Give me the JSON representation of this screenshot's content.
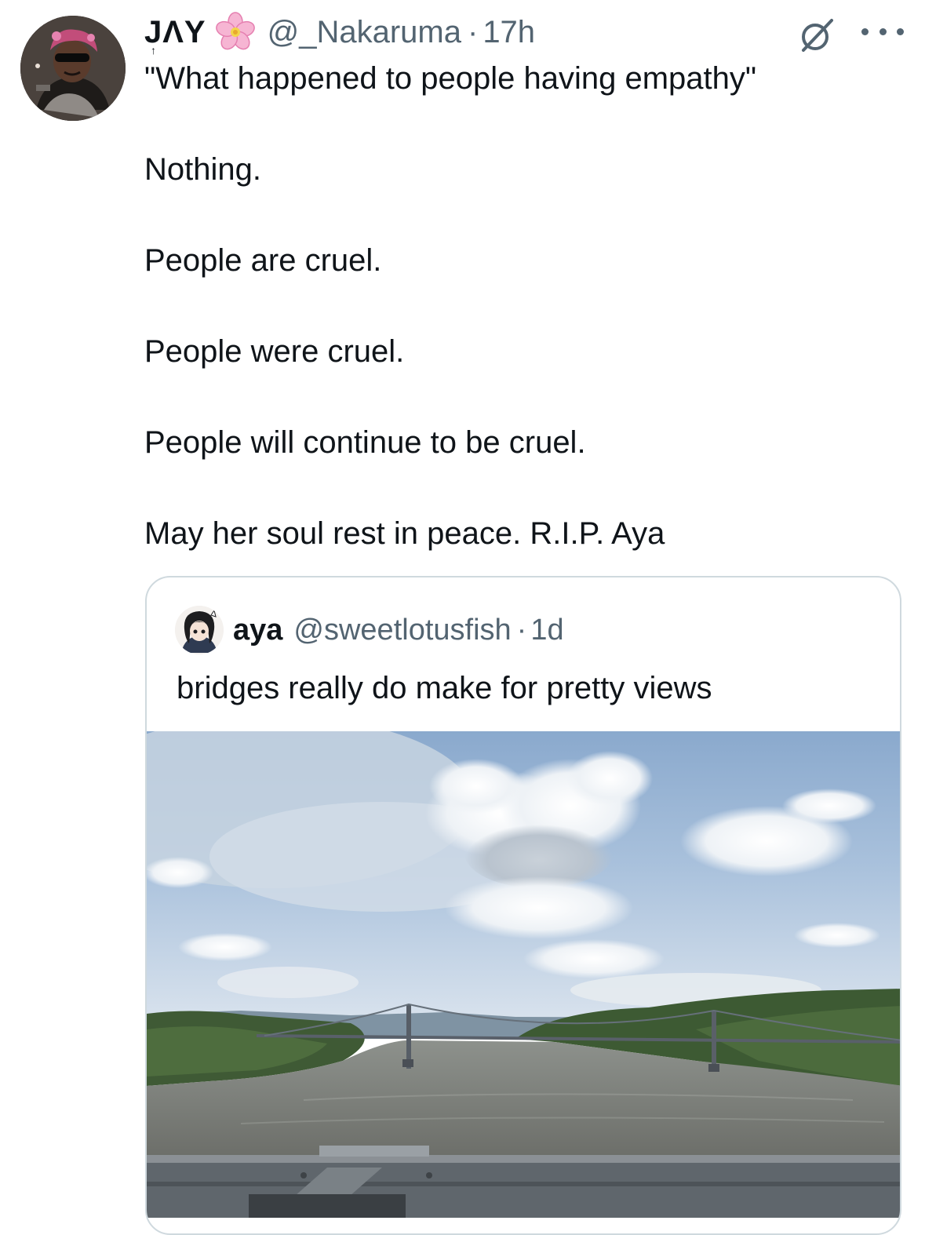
{
  "tweet": {
    "display_name": "JΛY",
    "name_accent": "↑",
    "flower_icon": "cherry-blossom-icon",
    "handle": "@_Nakaruma",
    "separator": "·",
    "timestamp": "17h",
    "lines": [
      "\"What happened to people having empathy\"",
      "Nothing.",
      "People are cruel.",
      "People were cruel.",
      "People will continue to be cruel.",
      "May her soul rest in peace. R.I.P. Aya"
    ]
  },
  "quote": {
    "display_name": "aya",
    "handle": "@sweetlotusfish",
    "separator": "·",
    "timestamp": "1d",
    "text": "bridges really do make for pretty views",
    "image_alt": "bridge-river-landscape-photo"
  },
  "colors": {
    "text_primary": "#0f1419",
    "text_secondary": "#536471",
    "border": "#cfd9de",
    "sky_top": "#6f97c4",
    "river": "#6d6f6a"
  }
}
